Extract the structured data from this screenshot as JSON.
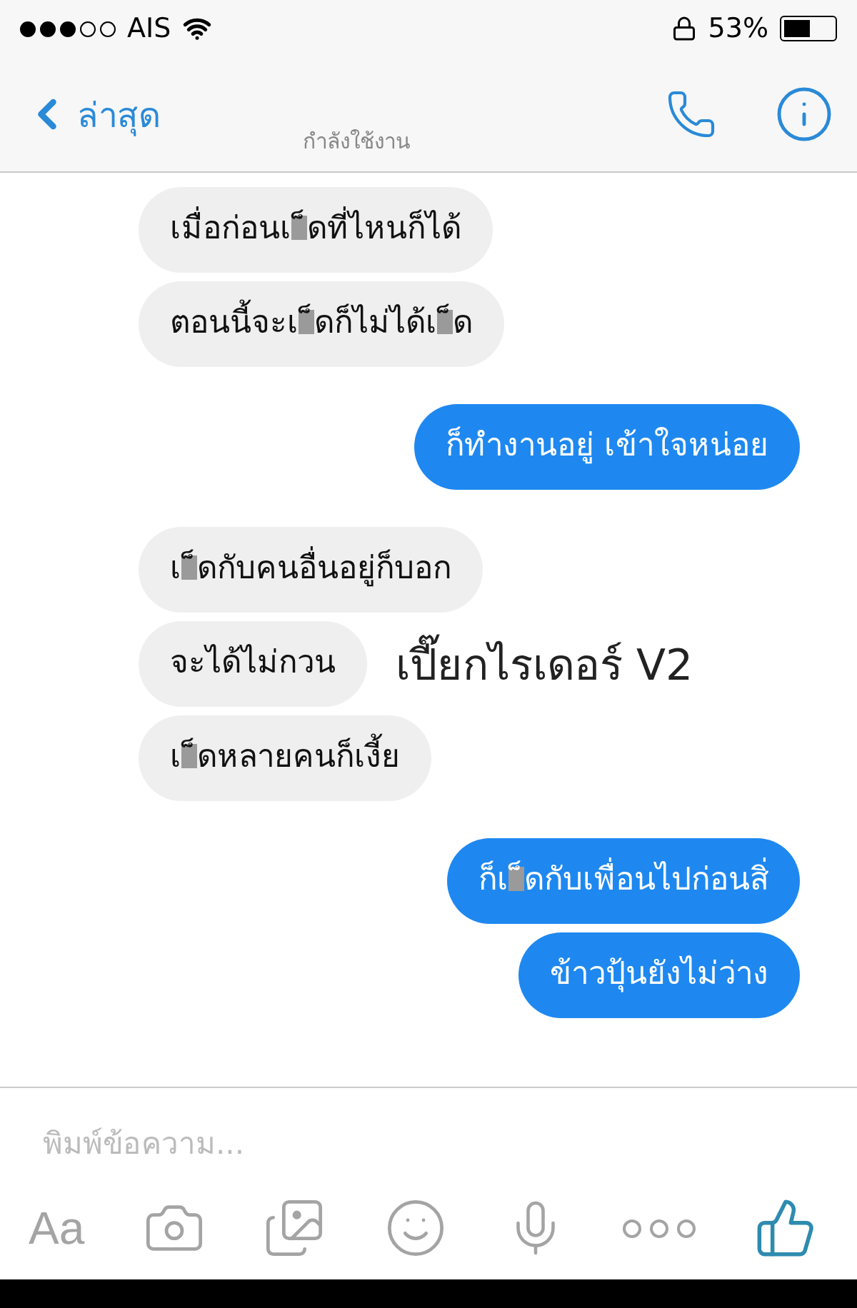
{
  "status_bar": {
    "carrier": "AIS",
    "battery": "53%"
  },
  "nav_bar": {
    "back_label": "ล่าสุด",
    "subtitle": "กำลังใช้งาน"
  },
  "messages": [
    {
      "kind": "received",
      "parts": [
        {
          "kind": "text",
          "text": "เมื่อก่อนเ"
        },
        {
          "kind": "censor"
        },
        {
          "kind": "text",
          "text": "็ดที่ไหนก็ได้"
        }
      ]
    },
    {
      "kind": "received",
      "parts": [
        {
          "kind": "text",
          "text": "ตอนนี้จะเ"
        },
        {
          "kind": "censor"
        },
        {
          "kind": "text",
          "text": "็ดก็ไม่ได้เ"
        },
        {
          "kind": "censor"
        },
        {
          "kind": "text",
          "text": "็ด"
        }
      ]
    },
    {
      "kind": "sent",
      "parts": [
        {
          "kind": "text",
          "text": "ก็ทำงานอยู่ เข้าใจหน่อย"
        }
      ]
    },
    {
      "kind": "received",
      "parts": [
        {
          "kind": "text",
          "text": "เ"
        },
        {
          "kind": "censor"
        },
        {
          "kind": "text",
          "text": "็ดกับคนอื่นอยู่ก็บอก"
        }
      ]
    },
    {
      "kind": "received",
      "parts": [
        {
          "kind": "text",
          "text": "จะได้ไม่กวน"
        }
      ],
      "caption": "เปี๊ยกไรเดอร์ V2"
    },
    {
      "kind": "received",
      "parts": [
        {
          "kind": "text",
          "text": "เ"
        },
        {
          "kind": "censor"
        },
        {
          "kind": "text",
          "text": "็ดหลายคนก็เงี้ย"
        }
      ]
    },
    {
      "kind": "sent",
      "parts": [
        {
          "kind": "text",
          "text": "ก็เ"
        },
        {
          "kind": "censor"
        },
        {
          "kind": "text",
          "text": "็ดกับเพื่อนไปก่อนสิ่"
        }
      ]
    },
    {
      "kind": "sent",
      "parts": [
        {
          "kind": "text",
          "text": "ข้าวปุ้นยังไม่ว่าง"
        }
      ]
    }
  ],
  "composer": {
    "placeholder": "พิมพ์ข้อความ..."
  },
  "toolbar": {
    "text_button": "Aa"
  }
}
